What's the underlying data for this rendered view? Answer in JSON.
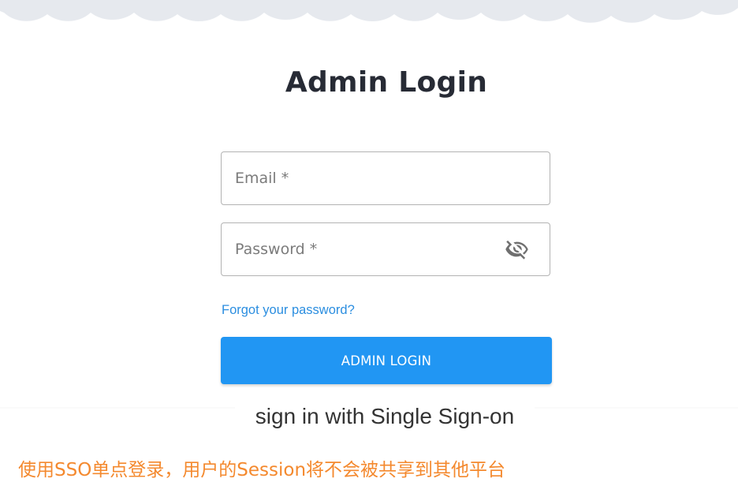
{
  "header": {
    "title": "Admin Login"
  },
  "form": {
    "email_placeholder": "Email *",
    "password_placeholder": "Password *",
    "forgot_link": "Forgot your password?",
    "submit_label": "ADMIN LOGIN"
  },
  "sso": {
    "label": "sign in with Single Sign-on"
  },
  "note": {
    "text": "使用SSO单点登录，用户的Session将不会被共享到其他平台"
  },
  "colors": {
    "primary": "#2196f3",
    "link": "#2b8ee0",
    "note": "#f4892e",
    "cloud": "#e6e9ee",
    "title": "#272b35"
  },
  "icons": {
    "password_toggle": "eye-off-icon"
  }
}
